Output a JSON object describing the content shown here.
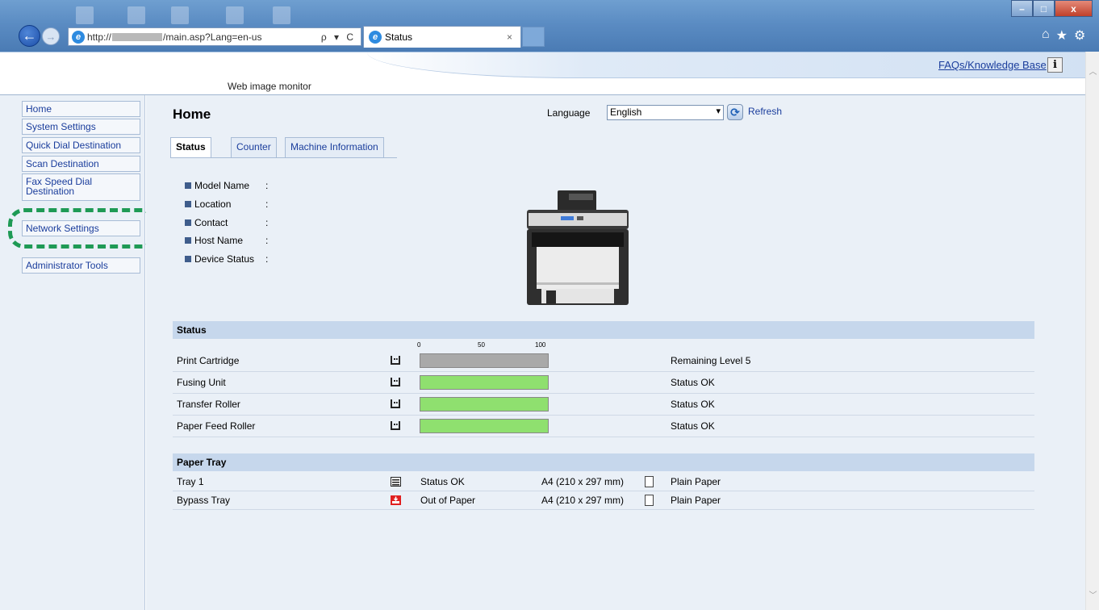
{
  "browser": {
    "url_prefix": "http://",
    "url_suffix": "/main.asp?Lang=en-us",
    "tab_title": "Status",
    "tab_close": "×",
    "address_tools": "ρ ▾ C",
    "window_controls": [
      "–",
      "□",
      "x"
    ],
    "toolbar_icons": [
      "home-icon",
      "star-icon",
      "gear-icon"
    ]
  },
  "header": {
    "faq_link": "FAQs/Knowledge Base",
    "info_icon": "i",
    "product_label": "Web image monitor"
  },
  "sidebar": {
    "items": [
      {
        "label": "Home"
      },
      {
        "label": "System Settings"
      },
      {
        "label": "Quick Dial Destination"
      },
      {
        "label": "Scan Destination"
      },
      {
        "label": "Fax Speed Dial Destination"
      },
      {
        "label": "Network Settings"
      },
      {
        "label": "Administrator Tools"
      }
    ]
  },
  "main": {
    "title": "Home",
    "language_label": "Language",
    "language_value": "English",
    "refresh_label": "Refresh",
    "tabs": [
      {
        "label": "Status",
        "active": true
      },
      {
        "label": "Counter",
        "active": false
      },
      {
        "label": "Machine Information",
        "active": false
      }
    ],
    "info_fields": [
      {
        "label": "Model Name",
        "sep": ":"
      },
      {
        "label": "Location",
        "sep": ":"
      },
      {
        "label": "Contact",
        "sep": ":"
      },
      {
        "label": "Host Name",
        "sep": ":"
      },
      {
        "label": "Device Status",
        "sep": ":"
      }
    ]
  },
  "status_section": {
    "header": "Status",
    "scale": [
      "0",
      "50",
      "100"
    ],
    "rows": [
      {
        "name": "Print Cartridge",
        "level_pct": 100,
        "color": "#a9a9a9",
        "state": "Remaining Level 5"
      },
      {
        "name": "Fusing Unit",
        "level_pct": 100,
        "color": "#8fe06f",
        "state": "Status OK"
      },
      {
        "name": "Transfer Roller",
        "level_pct": 100,
        "color": "#8fe06f",
        "state": "Status OK"
      },
      {
        "name": "Paper Feed Roller",
        "level_pct": 100,
        "color": "#8fe06f",
        "state": "Status OK"
      }
    ]
  },
  "paper_tray": {
    "header": "Paper Tray",
    "rows": [
      {
        "name": "Tray 1",
        "status": "Status OK",
        "size": "A4 (210 x 297 mm)",
        "type": "Plain Paper"
      },
      {
        "name": "Bypass Tray",
        "status": "Out of Paper",
        "size": "A4 (210 x 297 mm)",
        "type": "Plain Paper"
      }
    ]
  },
  "colors": {
    "link": "#1a3d9c",
    "panel_bg": "#eaf0f7",
    "section_header": "#c6d7ec",
    "annotation": "#1f9a55",
    "out_of_paper": "#e02020"
  }
}
